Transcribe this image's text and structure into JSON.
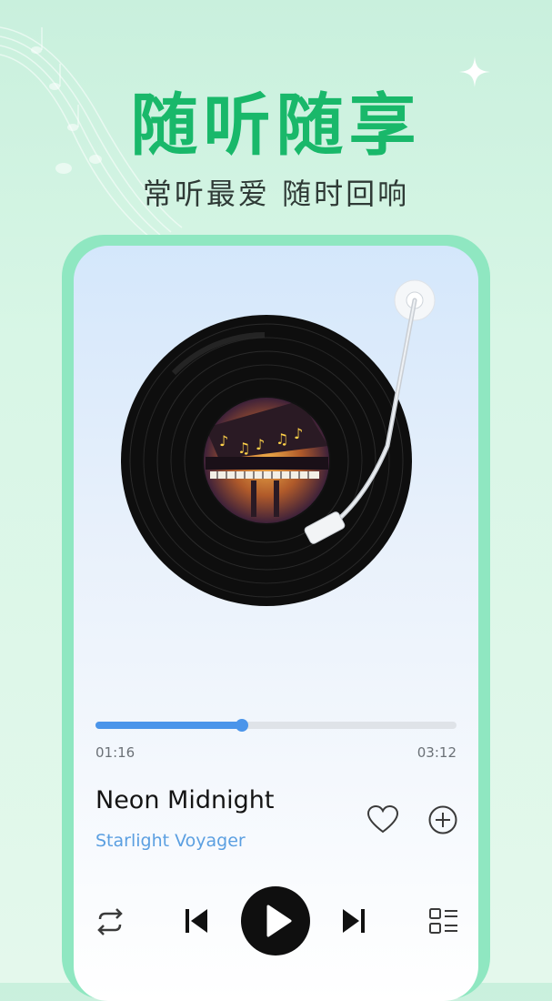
{
  "promo": {
    "headline": "随听随享",
    "subhead": "常听最爱 随时回响"
  },
  "player": {
    "album_art": "grand-piano-stage",
    "progress": {
      "fraction": 0.405,
      "current_time": "01:16",
      "total_time": "03:12"
    },
    "song": {
      "title": "Neon Midnight",
      "artist": "Starlight Voyager"
    },
    "actions": [
      "heart-icon",
      "plus-circle-icon"
    ],
    "controls": [
      "repeat-icon",
      "previous-icon",
      "play-icon",
      "next-icon",
      "playlist-icon"
    ]
  },
  "colors": {
    "headline_green": "#19b86a",
    "frame_mint": "#8fe7c1",
    "progress_blue": "#4b95ea",
    "artist_blue": "#5b9fe1"
  }
}
